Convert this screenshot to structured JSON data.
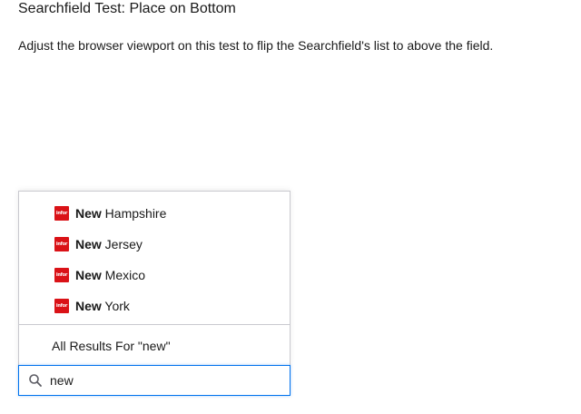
{
  "page": {
    "title": "Searchfield Test: Place on Bottom",
    "description": "Adjust the browser viewport on this test to flip the Searchfield's list to above the field."
  },
  "searchfield": {
    "value": "new",
    "results": [
      {
        "match": "New",
        "rest": " Hampshire",
        "icon": "infor-logo-icon"
      },
      {
        "match": "New",
        "rest": " Jersey",
        "icon": "infor-logo-icon"
      },
      {
        "match": "New",
        "rest": " Mexico",
        "icon": "infor-logo-icon"
      },
      {
        "match": "New",
        "rest": " York",
        "icon": "infor-logo-icon"
      }
    ],
    "logo_text": "infor",
    "all_results_label": "All Results For \"new\""
  },
  "colors": {
    "accent": "#0072ed",
    "logo": "#da1217",
    "border": "#c9c9cf"
  }
}
